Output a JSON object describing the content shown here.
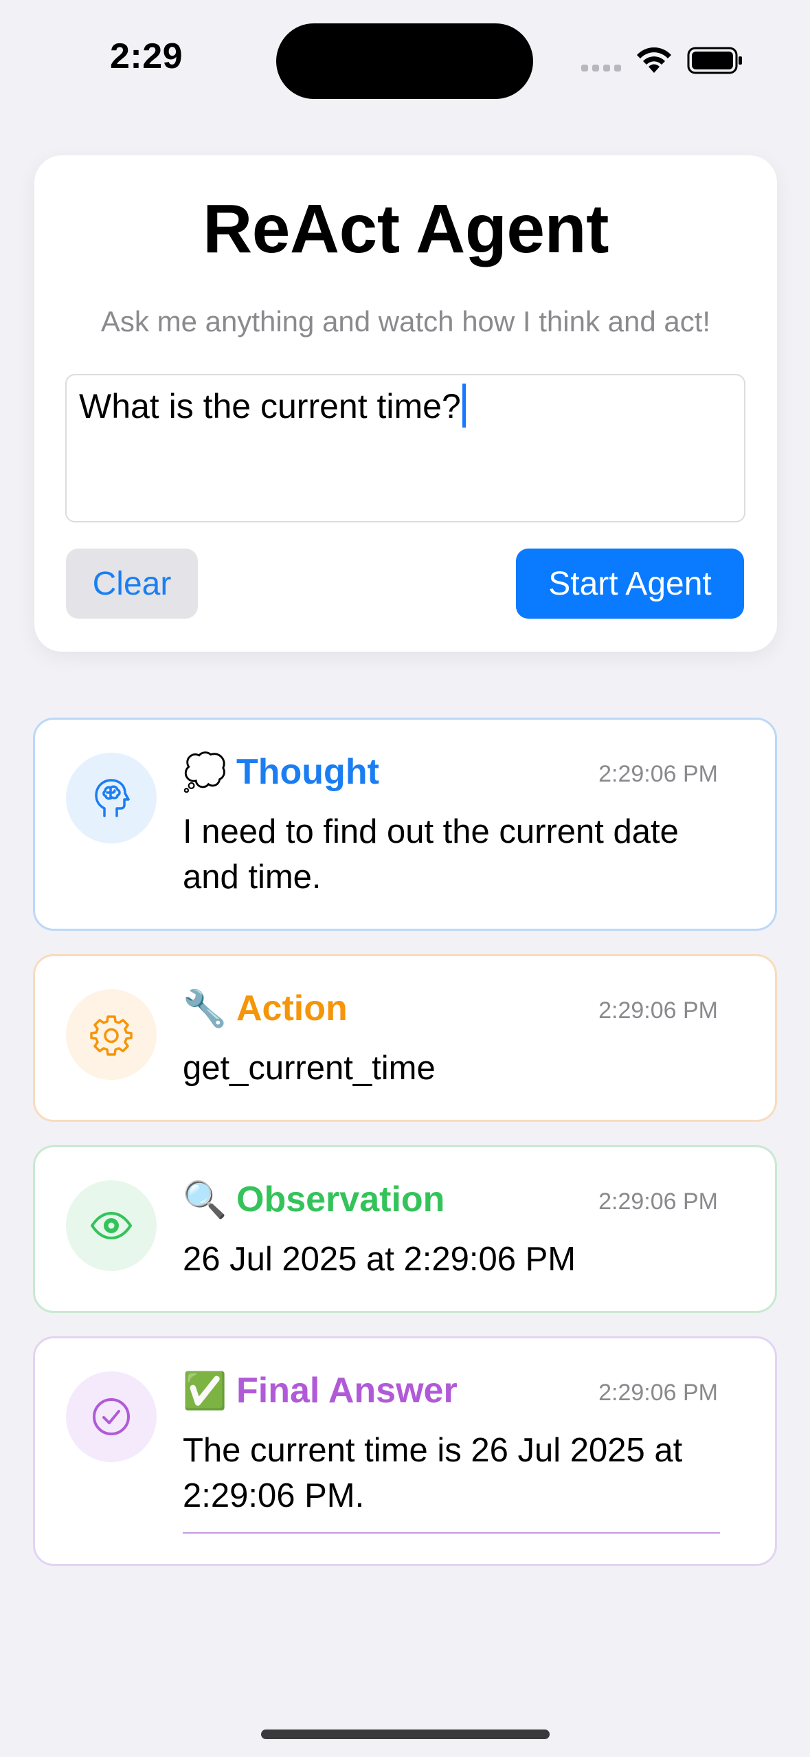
{
  "status_bar": {
    "time": "2:29"
  },
  "agent": {
    "title": "ReAct Agent",
    "subtitle": "Ask me anything and watch how I think and act!",
    "input_value": "What is the current time?",
    "clear_label": "Clear",
    "start_label": "Start Agent"
  },
  "steps": [
    {
      "kind": "thought",
      "emoji": "💭",
      "label": "Thought",
      "time": "2:29:06 PM",
      "text": "I need to find out the current date and time.",
      "icon": "brain-head-icon",
      "color": "#1a7ef2"
    },
    {
      "kind": "action",
      "emoji": "🔧",
      "label": "Action",
      "time": "2:29:06 PM",
      "text": "get_current_time",
      "icon": "gear-icon",
      "color": "#f5950a"
    },
    {
      "kind": "observation",
      "emoji": "🔍",
      "label": "Observation",
      "time": "2:29:06 PM",
      "text": "26 Jul 2025 at 2:29:06 PM",
      "icon": "eye-icon",
      "color": "#34c35a"
    },
    {
      "kind": "final",
      "emoji": "✅",
      "label": "Final Answer",
      "time": "2:29:06 PM",
      "text": "The current time is 26 Jul 2025 at 2:29:06 PM.",
      "icon": "checkmark-circle-icon",
      "color": "#b15ad8"
    }
  ]
}
